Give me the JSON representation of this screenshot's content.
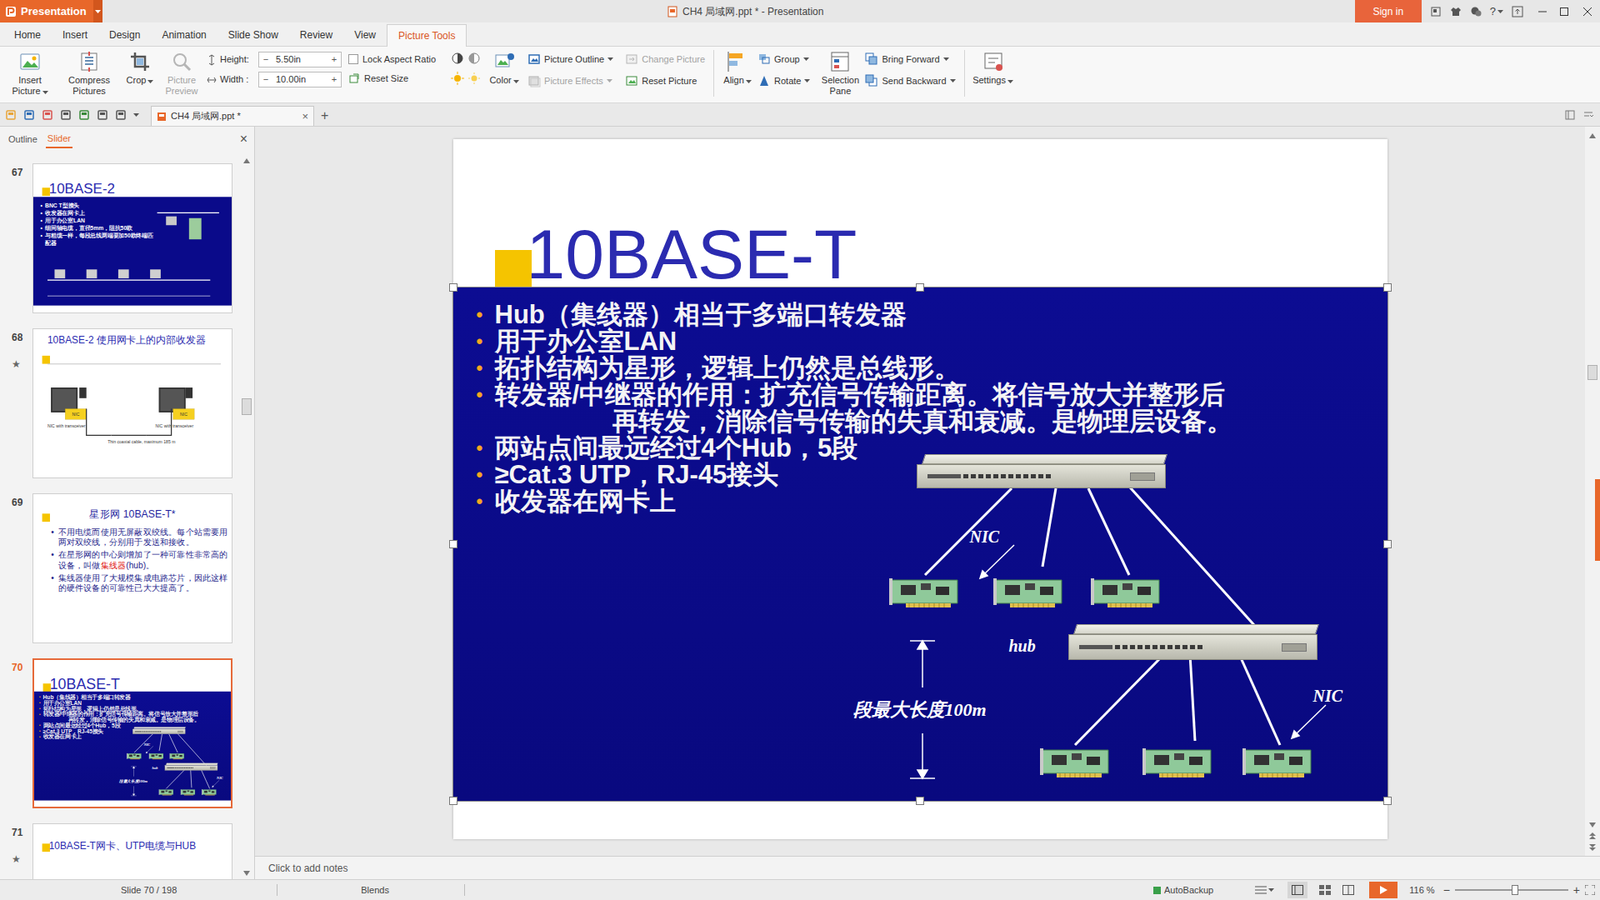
{
  "window": {
    "app_button": "Presentation",
    "title": "CH4 局域网.ppt * - Presentation",
    "sign_in": "Sign in",
    "help": "?"
  },
  "menu_tabs": [
    {
      "label": "Home",
      "selected": false
    },
    {
      "label": "Insert",
      "selected": false
    },
    {
      "label": "Design",
      "selected": false
    },
    {
      "label": "Animation",
      "selected": false
    },
    {
      "label": "Slide Show",
      "selected": false
    },
    {
      "label": "Review",
      "selected": false
    },
    {
      "label": "View",
      "selected": false
    },
    {
      "label": "Picture Tools",
      "selected": true
    }
  ],
  "ribbon": {
    "large_buttons": [
      {
        "label": "Insert Picture",
        "dropdown": true,
        "disabled": false
      },
      {
        "label": "Compress Pictures",
        "dropdown": false,
        "disabled": false
      },
      {
        "label": "Crop",
        "dropdown": true,
        "disabled": false
      },
      {
        "label": "Picture Preview",
        "dropdown": false,
        "disabled": true
      }
    ],
    "size": {
      "height_label": "Height:",
      "height": "5.50in",
      "width_label": "Width :",
      "width": "10.00in",
      "minus": "−",
      "plus": "+"
    },
    "lock_aspect_ratio": {
      "label": "Lock Aspect Ratio",
      "checked": false
    },
    "reset_size": "Reset Size",
    "color": {
      "label": "Color",
      "dropdown": true
    },
    "picture_items": [
      {
        "label": "Picture Outline",
        "dropdown": true,
        "disabled": false
      },
      {
        "label": "Picture Effects",
        "dropdown": true,
        "disabled": true
      },
      {
        "label": "Change Picture",
        "dropdown": false,
        "disabled": true
      },
      {
        "label": "Reset Picture",
        "dropdown": false,
        "disabled": false
      }
    ],
    "align": "Align",
    "group": "Group",
    "rotate": "Rotate",
    "selection_pane": "Selection Pane",
    "bring_forward": "Bring Forward",
    "send_backward": "Send Backward",
    "settings": "Settings"
  },
  "document_tabs": {
    "tabs": [
      {
        "label": "CH4 局域网.ppt *",
        "selected": true,
        "close": "×"
      }
    ],
    "new_tab": "+"
  },
  "side_panel": {
    "tabs": [
      {
        "label": "Outline",
        "selected": false
      },
      {
        "label": "Slider",
        "selected": true
      }
    ],
    "close": "×",
    "star": "★",
    "thumbnails": [
      {
        "number": "67",
        "selected": false,
        "starred": false,
        "kind": "image",
        "title": "10BASE-2",
        "bullets": [
          "BNC T型接头",
          "收发器在网卡上",
          "用于办公室LAN",
          "细同轴电缆，直径5mm，阻抗50欧",
          "与粗缆一样，每段总线两端要加50欧终端匹配器"
        ]
      },
      {
        "number": "68",
        "selected": false,
        "starred": true,
        "kind": "diagram",
        "title": "10BASE-2 使用网卡上的内部收发器",
        "nic": "NIC",
        "device_label": "NIC with transceiver",
        "cable_label": "Thin coaxial cable, maximum 185 m"
      },
      {
        "number": "69",
        "selected": false,
        "starred": false,
        "kind": "bullets",
        "title": "星形网 10BASE-T*",
        "bullets": [
          [
            {
              "text": "不用电缆而使用无屏蔽双绞线。每个站需要用两对双绞线，分别用于发送和接收。",
              "highlight": false
            }
          ],
          [
            {
              "text": "在星形网的中心则增加了一种可靠性非常高的设备，叫做",
              "highlight": false
            },
            {
              "text": "集线器",
              "highlight": true
            },
            {
              "text": "(hub)。",
              "highlight": false
            }
          ],
          [
            {
              "text": "集线器使用了大规模集成电路芯片，因此这样的硬件设备的可靠性已大大提高了。",
              "highlight": false
            }
          ]
        ]
      },
      {
        "number": "70",
        "selected": true,
        "starred": false,
        "kind": "current"
      },
      {
        "number": "71",
        "selected": false,
        "starred": true,
        "kind": "title_image",
        "title": "10BASE-T网卡、UTP电缆与HUB"
      }
    ]
  },
  "slide": {
    "title": "10BASE-T",
    "bullet": "•",
    "picture_selected": true,
    "bullets": [
      {
        "lines": [
          "Hub（集线器）相当于多端口转发器"
        ]
      },
      {
        "lines": [
          "用于办公室LAN"
        ]
      },
      {
        "lines": [
          "拓扑结构为星形，逻辑上仍然是总线形。"
        ]
      },
      {
        "lines": [
          "转发器/中继器的作用：扩充信号传输距离。将信号放大并整形后",
          "再转发，消除信号传输的失真和衰减。是物理层设备。"
        ]
      },
      {
        "lines": [
          "两站点间最远经过4个Hub，5段"
        ]
      },
      {
        "lines": [
          "≥Cat.3 UTP，RJ-45接头"
        ]
      },
      {
        "lines": [
          "收发器在网卡上"
        ]
      }
    ],
    "labels": {
      "nic_top": "NIC",
      "hub": "hub",
      "nic_bottom": "NIC",
      "segment": "段最大长度100m"
    }
  },
  "notes": {
    "placeholder": "Click to add notes"
  },
  "status_bar": {
    "slide": "Slide 70 / 198",
    "theme": "Blends",
    "autobackup": "AutoBackup",
    "zoom": "116 %",
    "zoom_level": 0.53,
    "zoom_minus": "−",
    "zoom_plus": "+"
  }
}
